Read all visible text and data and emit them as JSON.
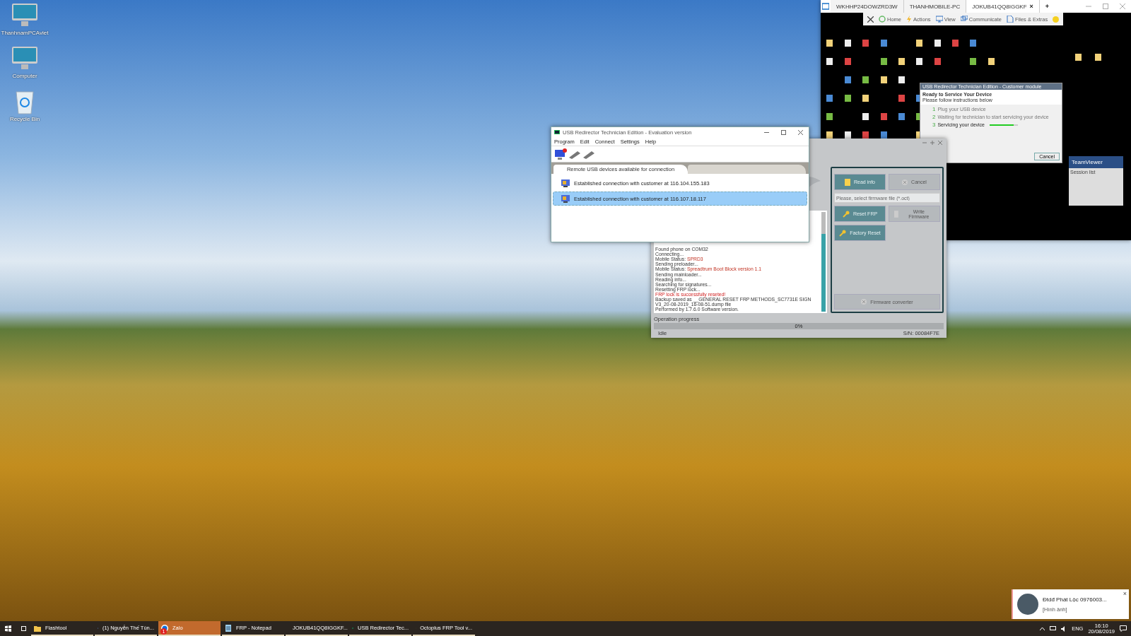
{
  "desktop": {
    "icons": [
      {
        "label": "ThanhnamPCAviet",
        "kind": "monitor"
      },
      {
        "label": "Computer",
        "kind": "monitor"
      },
      {
        "label": "Recycle Bin",
        "kind": "bin"
      }
    ]
  },
  "teamviewer": {
    "tabs": [
      {
        "label": "WKHHP24DOWZRD3W",
        "selected": false
      },
      {
        "label": "THANHMOBILE-PC",
        "selected": false
      },
      {
        "label": "JOKUB41QQ8IGGKF",
        "selected": true,
        "close": "×"
      }
    ],
    "new_tab": "+",
    "toolbar": [
      {
        "label": "Home",
        "kind": "home"
      },
      {
        "label": "Actions",
        "kind": "actions"
      },
      {
        "label": "View",
        "kind": "view"
      },
      {
        "label": "Communicate",
        "kind": "communicate"
      },
      {
        "label": "Files & Extras",
        "kind": "files"
      }
    ],
    "remote": {
      "dialog": {
        "title": "USB Redirector Technician Edition - Customer module",
        "heading": "Ready to Service Your Device",
        "subheading": "Please follow instructions below",
        "steps": [
          {
            "number": "1",
            "title": "Plug your USB device",
            "active": false
          },
          {
            "number": "2",
            "title": "Waiting for technician to start servicing your device",
            "active": false
          },
          {
            "number": "3",
            "title": "Servicing your device",
            "active": true,
            "level": 0.85
          }
        ],
        "cancel": "Cancel"
      },
      "panel": {
        "title": "TeamViewer",
        "session": "Session list"
      }
    }
  },
  "octoplus": {
    "buttons": [
      {
        "label": "Read info",
        "disabled": false,
        "kind": "doc"
      },
      {
        "label": "Cancel",
        "disabled": true,
        "kind": "cancel"
      },
      {
        "label": "Reset FRP",
        "disabled": false,
        "kind": "wrench"
      },
      {
        "label": "Write Firmware",
        "disabled": true,
        "kind": "chip"
      },
      {
        "label": "Factory Reset",
        "disabled": false,
        "kind": "wrench"
      }
    ],
    "firmware_field": {
      "placeholder": "Please, select firmware file (*.oct)"
    },
    "converter": {
      "label": "Firmware converter",
      "disabled": true
    },
    "log": [
      {
        "text": "Found phone on COM32",
        "kind": "plain"
      },
      {
        "text": "Connecting...",
        "kind": "plain"
      },
      {
        "text": "Mobile Status:",
        "value": "SPRD3",
        "kind": "value"
      },
      {
        "text": "Sending preloader...",
        "kind": "plain"
      },
      {
        "text": "Mobile Status:",
        "value": "Spreadtrum Boot Block version 1.1",
        "kind": "value"
      },
      {
        "text": "Sending mainloader...",
        "kind": "plain"
      },
      {
        "text": "Reading info...",
        "kind": "plain"
      },
      {
        "text": "Searching for signatures...",
        "kind": "plain"
      },
      {
        "text": "Resetting FRP lock...",
        "kind": "plain"
      },
      {
        "text": "FRP lock is successfully reseted!",
        "kind": "alert"
      },
      {
        "text": "Backup saved as __GENERAL RESET FRP METHODS_SC7731E SIGN V3_20-08-2019_16-08-51.dump file",
        "kind": "plain"
      },
      {
        "text": "Performed by 1.7.6.0 Software version.",
        "kind": "plain"
      }
    ],
    "progress": {
      "label": "Operation progress",
      "level": 0,
      "reading": "0%"
    },
    "status": "Idle",
    "serial": "S/N: 00084F7E"
  },
  "usb_redirector": {
    "title": "USB Redirector Technician Edition - Evaluation version",
    "menu": [
      "Program",
      "Edit",
      "Connect",
      "Settings",
      "Help"
    ],
    "tabs": [
      {
        "label": "Remote USB devices available for connection",
        "selected": true
      },
      {
        "selected": false
      }
    ],
    "connections": [
      {
        "label": "Established connection with customer at 116.104.155.183",
        "selected": false
      },
      {
        "label": "Established connection with customer at 116.107.18.117",
        "selected": true
      }
    ]
  },
  "notification": {
    "title": "Đtdđ Phát Lộc 0976003...",
    "body": "[Hình ảnh]",
    "close": "×"
  },
  "taskbar": {
    "items": [
      {
        "label": "Flashtool",
        "active": false,
        "kind": "folder"
      },
      {
        "label": "(1) Nguyễn Thế Tùn...",
        "active": false,
        "kind": "browser"
      },
      {
        "label": "Zalo",
        "active": true,
        "kind": "zalo",
        "badge": "1"
      },
      {
        "label": "FRP - Notepad",
        "active": false,
        "kind": "notepad"
      },
      {
        "label": "JOKUB41QQ8IGGKF...",
        "active": false,
        "kind": "teamviewer"
      },
      {
        "label": "USB Redirector Tec...",
        "active": false,
        "kind": "usb"
      },
      {
        "label": "Octoplus FRP Tool v...",
        "active": false,
        "kind": "octoplus"
      }
    ],
    "language": "ENG",
    "time": "16:10",
    "date": "20/08/2019"
  }
}
